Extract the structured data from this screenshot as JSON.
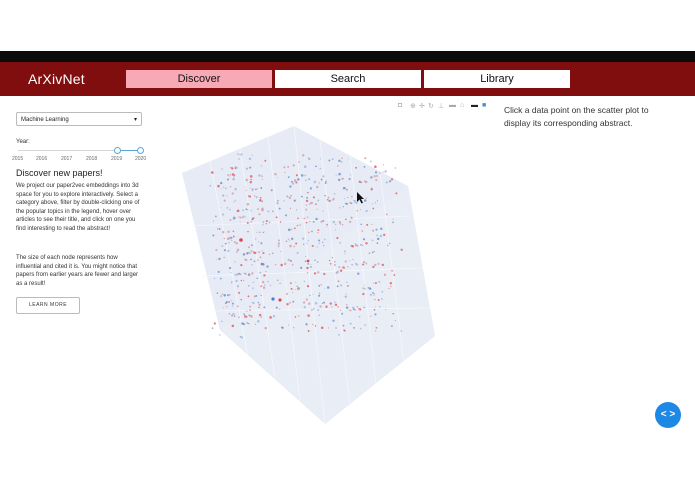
{
  "header": {
    "brand": "ArXivNet",
    "tabs": [
      {
        "label": "Discover",
        "active": true
      },
      {
        "label": "Search",
        "active": false
      },
      {
        "label": "Library",
        "active": false
      }
    ]
  },
  "sidebar": {
    "category_select": "Machine Learning",
    "year_label": "Year:",
    "year_ticks": [
      "2015",
      "2016",
      "2017",
      "2018",
      "2019",
      "2020"
    ],
    "year_range": [
      "2019",
      "2020"
    ],
    "title": "Discover new papers!",
    "paragraph1": "We project our paper2vec embeddings into 3d space for you to explore interactively. Select a category above, filter by double-clicking one of the popular topics in the legend, hover over articles to see their title, and click on one you find interesting to read the abstract!",
    "paragraph2": "The size of each node represents how influential and cited it is. You might notice that papers from earlier years are fewer and larger as a result!",
    "learn_more": "LEARN MORE"
  },
  "plot": {
    "modebar_icons": [
      "camera-icon",
      "zoom-icon",
      "pan-icon",
      "orbit-icon",
      "turntable-icon",
      "reset-icon",
      "home-icon",
      "spike-icon",
      "plotly-logo-icon"
    ],
    "colors": {
      "background": "#e6ebf5",
      "points": [
        "#6f8fc9",
        "#e0575c",
        "#d89aa0",
        "#9fb9de"
      ]
    }
  },
  "hint": "Click a data point on the scatter plot to display its corresponding abstract.",
  "fab_icon": "code-arrows-icon",
  "colors": {
    "header": "#800e0e",
    "active_tab": "#f7aab6",
    "fab": "#1e88e5"
  }
}
